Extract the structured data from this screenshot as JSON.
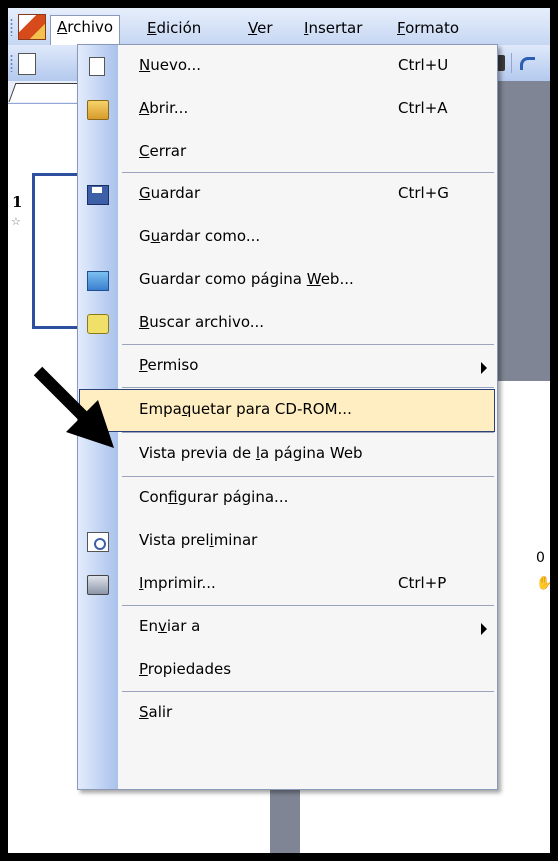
{
  "menubar": {
    "items": [
      {
        "pre": "",
        "u": "A",
        "post": "rchivo"
      },
      {
        "pre": "",
        "u": "E",
        "post": "dición"
      },
      {
        "pre": "",
        "u": "V",
        "post": "er"
      },
      {
        "pre": "",
        "u": "I",
        "post": "nsertar"
      },
      {
        "pre": "",
        "u": "F",
        "post": "ormato"
      }
    ]
  },
  "outline": {
    "slide_number": "1"
  },
  "workspace": {
    "zero_label": "0"
  },
  "menu": {
    "items": [
      {
        "pre": "",
        "u": "N",
        "post": "uevo...",
        "shortcut": "Ctrl+U"
      },
      {
        "pre": "",
        "u": "A",
        "post": "brir...",
        "shortcut": "Ctrl+A"
      },
      {
        "pre": "",
        "u": "C",
        "post": "errar",
        "shortcut": ""
      },
      {
        "pre": "",
        "u": "G",
        "post": "uardar",
        "shortcut": "Ctrl+G"
      },
      {
        "pre": "G",
        "u": "u",
        "post": "ardar como...",
        "shortcut": ""
      },
      {
        "pre": "Guardar como página ",
        "u": "W",
        "post": "eb...",
        "shortcut": ""
      },
      {
        "pre": "",
        "u": "B",
        "post": "uscar archivo...",
        "shortcut": ""
      },
      {
        "pre": "",
        "u": "P",
        "post": "ermiso",
        "shortcut": ""
      },
      {
        "pre": "Empa",
        "u": "q",
        "post": "uetar para CD-ROM...",
        "shortcut": ""
      },
      {
        "pre": "Vista previa de ",
        "u": "l",
        "post": "a página Web",
        "shortcut": ""
      },
      {
        "pre": "Con",
        "u": "f",
        "post": "igurar página...",
        "shortcut": ""
      },
      {
        "pre": "Vista prel",
        "u": "i",
        "post": "minar",
        "shortcut": ""
      },
      {
        "pre": "",
        "u": "I",
        "post": "mprimir...",
        "shortcut": "Ctrl+P"
      },
      {
        "pre": "En",
        "u": "v",
        "post": "iar a",
        "shortcut": ""
      },
      {
        "pre": "",
        "u": "P",
        "post": "ropiedades",
        "shortcut": ""
      },
      {
        "pre": "",
        "u": "S",
        "post": "alir",
        "shortcut": ""
      }
    ]
  },
  "icons": {
    "app": "powerpoint-icon",
    "nuevo": "new-document-icon",
    "abrir": "open-folder-icon",
    "guardar": "save-disk-icon",
    "guardar_web": "save-web-icon",
    "buscar": "search-file-icon",
    "vista_preliminar": "print-preview-icon",
    "imprimir": "printer-icon"
  },
  "colors": {
    "highlight": "#ffeec2",
    "gutter": "#a9c1ec",
    "frame": "#000000"
  }
}
